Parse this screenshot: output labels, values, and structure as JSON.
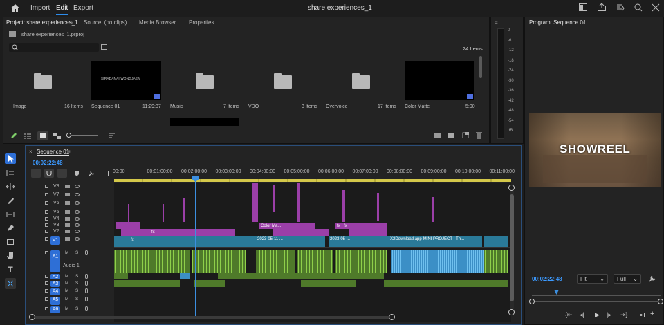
{
  "menu": {
    "home_icon": "home-icon",
    "import": "Import",
    "edit": "Edit",
    "export": "Export",
    "title": "share experiences_1"
  },
  "project": {
    "tabs": [
      "Project: share experiences_1",
      "Source: (no clips)",
      "Media Browser",
      "Properties"
    ],
    "file": "share experiences_1.prproj",
    "count": "24 Items",
    "bins": [
      {
        "name": "Image",
        "count": "16 Items",
        "kind": "folder"
      },
      {
        "name": "Sequence 01",
        "count": "11:29:37",
        "kind": "thumb"
      },
      {
        "name": "Music",
        "count": "7 Items",
        "kind": "folder"
      },
      {
        "name": "VDO",
        "count": "3 Items",
        "kind": "folder"
      },
      {
        "name": "Overvoice",
        "count": "17 Items",
        "kind": "folder"
      },
      {
        "name": "Color Matte",
        "count": "5:00",
        "kind": "black"
      }
    ],
    "thumb_text": "SIRADANAI WONGJAEN"
  },
  "meter": {
    "labels": [
      "0",
      "-6",
      "-12",
      "-18",
      "-24",
      "-30",
      "-36",
      "-42",
      "-48",
      "-54",
      "dB"
    ]
  },
  "timeline": {
    "tab": "Sequence 01",
    "timecode": "00:02:22:48",
    "ruler": [
      "00:00",
      "00:01:00:00",
      "00:02:00:00",
      "00:03:00:00",
      "00:04:00:00",
      "00:05:00:00",
      "00:06:00:00",
      "00:07:00:00",
      "00:08:00:00",
      "00:09:00:00",
      "00:10:00:00",
      "00:11:00:00"
    ],
    "video_tracks": [
      "V8",
      "V7",
      "V6",
      "V5",
      "V4",
      "V3",
      "V2",
      "V1"
    ],
    "audio_tracks": [
      "A1",
      "A2",
      "A3",
      "A4",
      "A5",
      "A6"
    ],
    "audio1_name": "Audio 1",
    "clips": {
      "color_matte": "Color Ma...",
      "date1": "2023-05-11 ...",
      "date2": "2023-05-...",
      "x2": "X2Download.app-MINI PROJECT - Th...",
      "fx": "fx"
    }
  },
  "program": {
    "title": "Program: Sequence 01",
    "overlay": "SHOWREEL",
    "timecode": "00:02:22:48",
    "fit": "Fit",
    "full": "Full"
  }
}
